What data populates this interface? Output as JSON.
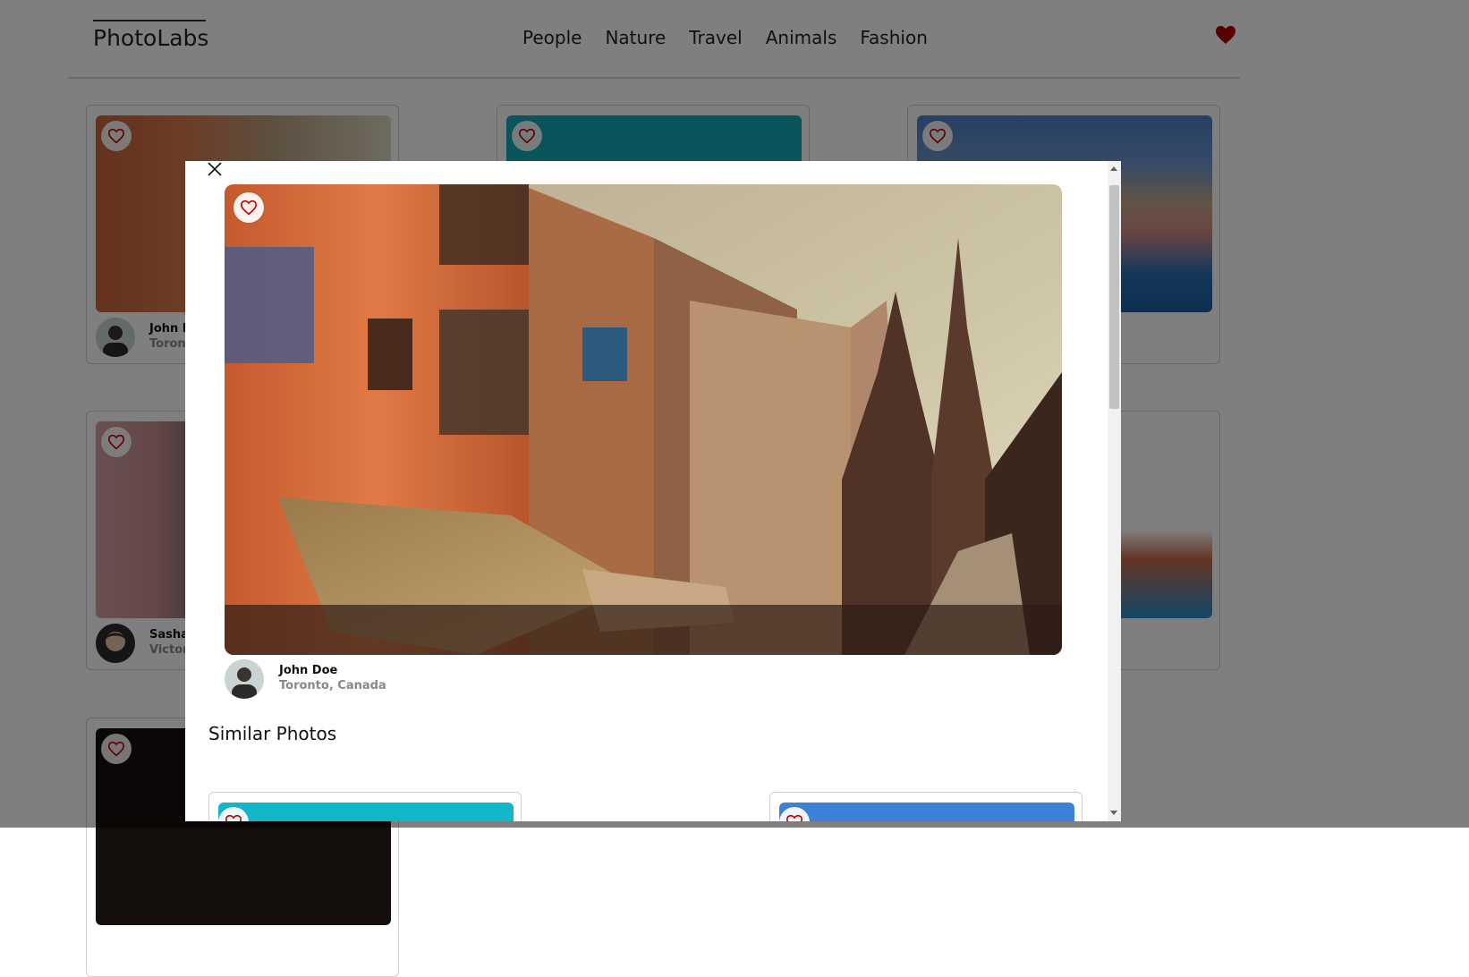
{
  "app": {
    "logo": "PhotoLabs"
  },
  "nav": {
    "topics": [
      "People",
      "Nature",
      "Travel",
      "Animals",
      "Fashion"
    ],
    "fav_color": "#b00000"
  },
  "grid": {
    "cards": [
      {
        "name": "John D",
        "location": "Toront"
      },
      {
        "name": "",
        "location": ""
      },
      {
        "name": "",
        "location": ""
      },
      {
        "name": "Sasha",
        "location": "Victori"
      },
      {
        "name": "",
        "location": ""
      },
      {
        "name": "",
        "location": ""
      },
      {
        "name": "",
        "location": ""
      }
    ]
  },
  "modal": {
    "user": {
      "name": "John Doe",
      "location": "Toronto, Canada"
    },
    "similar_title": "Similar Photos"
  },
  "colors": {
    "heart_red": "#c00000",
    "accent_teal": "#12b6c9",
    "accent_blue": "#3b82d8"
  }
}
